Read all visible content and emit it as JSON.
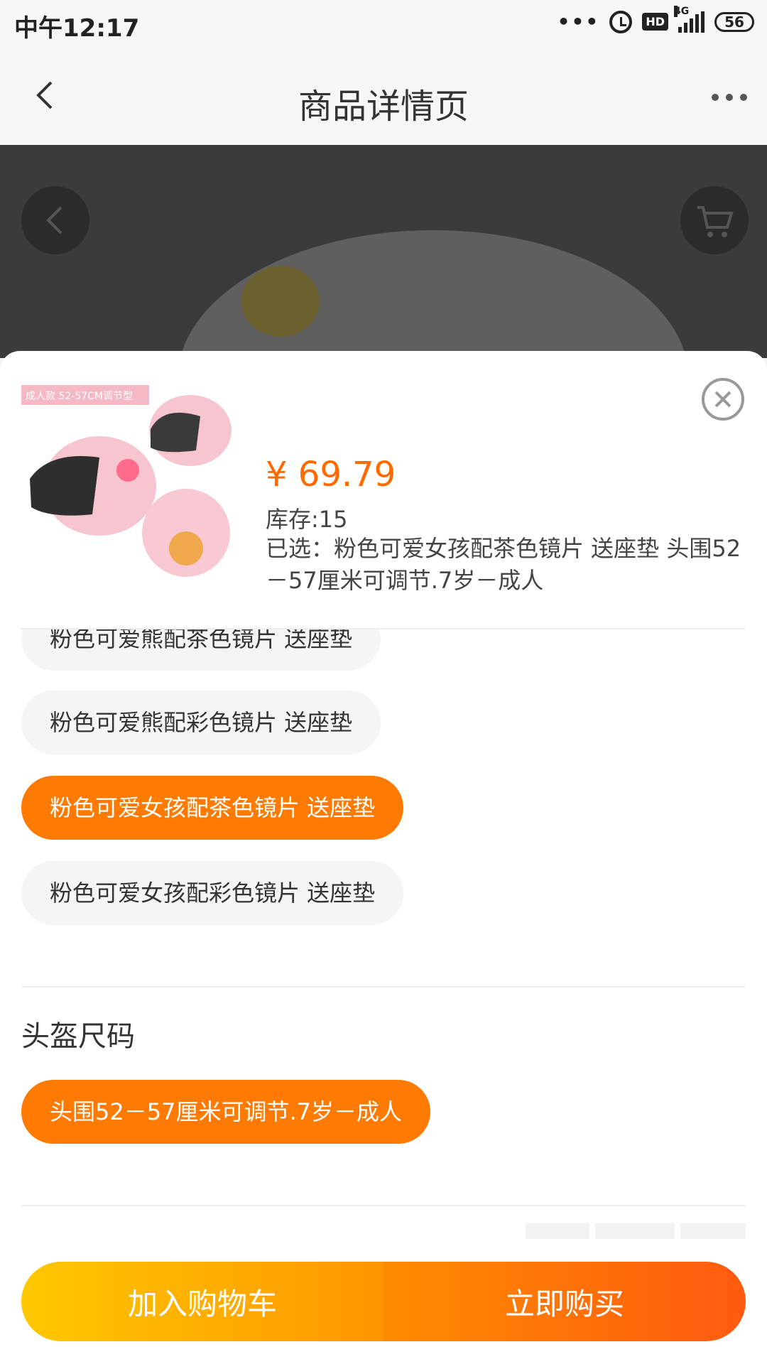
{
  "status_bar": {
    "time": "中午12:17",
    "network": "4G",
    "hd_label": "HD",
    "battery": "56"
  },
  "nav": {
    "title": "商品详情页"
  },
  "sheet": {
    "price": "¥ 69.79",
    "stock": "库存:15",
    "selected": "已选：粉色可爱女孩配茶色镜片 送座垫 头围52－57厘米可调节.7岁－成人",
    "thumb_badge": "成人款 52-57CM调节型",
    "accent_color": "#ff7a00"
  },
  "options": {
    "color_options": [
      "粉色可爱熊配茶色镜片 送座垫",
      "粉色可爱熊配彩色镜片 送座垫",
      "粉色可爱女孩配茶色镜片 送座垫",
      "粉色可爱女孩配彩色镜片 送座垫"
    ],
    "size_section_title": "头盔尺码",
    "size_options": [
      "头围52－57厘米可调节.7岁－成人"
    ]
  },
  "actions": {
    "add_to_cart": "加入购物车",
    "buy_now": "立即购买"
  }
}
